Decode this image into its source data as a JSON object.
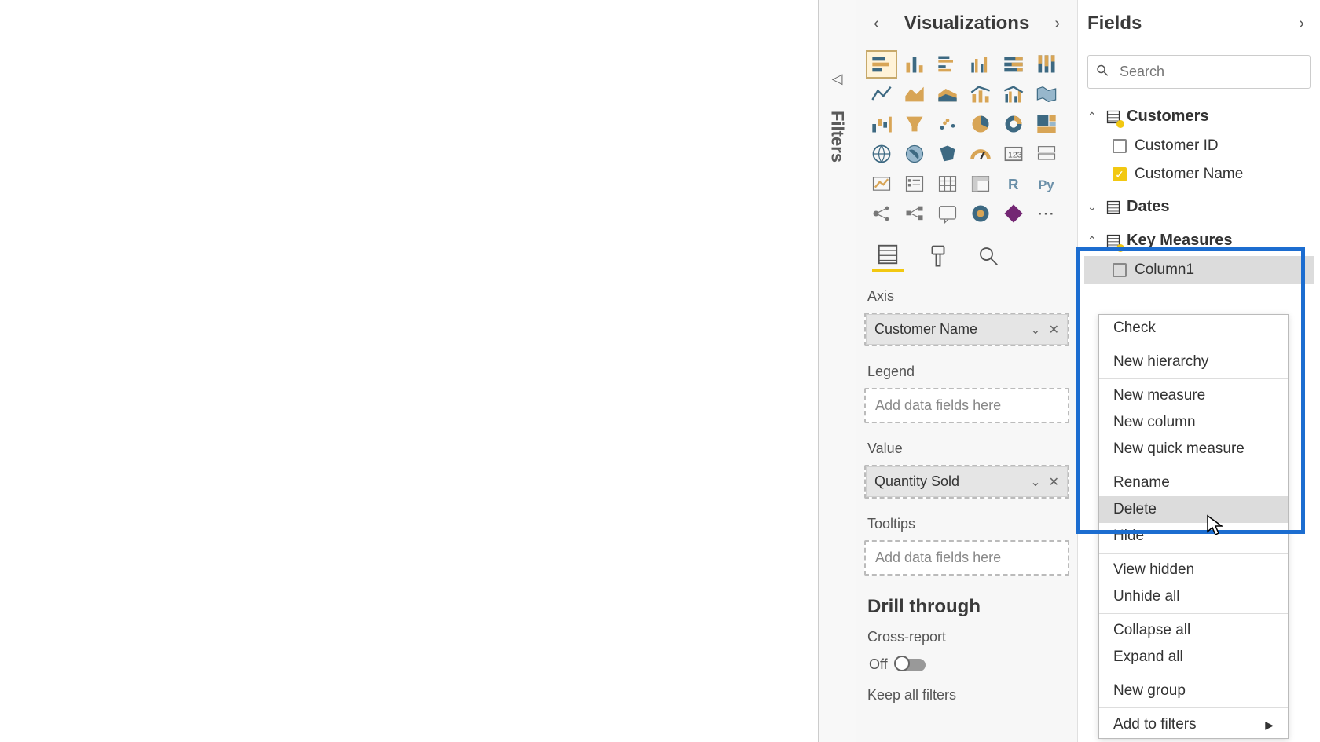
{
  "filters_label": "Filters",
  "visualizations": {
    "title": "Visualizations",
    "wells": {
      "axis_label": "Axis",
      "axis_field": "Customer Name",
      "legend_label": "Legend",
      "legend_placeholder": "Add data fields here",
      "value_label": "Value",
      "value_field": "Quantity Sold",
      "tooltips_label": "Tooltips",
      "tooltips_placeholder": "Add data fields here"
    },
    "drill": {
      "heading": "Drill through",
      "cross_report_label": "Cross-report",
      "cross_report_state": "Off",
      "keep_all_filters_label": "Keep all filters"
    }
  },
  "fields": {
    "title": "Fields",
    "search_placeholder": "Search",
    "tables": {
      "customers": {
        "name": "Customers",
        "items": [
          {
            "label": "Customer ID",
            "checked": false
          },
          {
            "label": "Customer Name",
            "checked": true
          }
        ]
      },
      "dates": {
        "name": "Dates"
      },
      "key_measures": {
        "name": "Key Measures",
        "items": [
          {
            "label": "Column1",
            "checked": false
          }
        ]
      }
    }
  },
  "context_menu": {
    "check": "Check",
    "new_hierarchy": "New hierarchy",
    "new_measure": "New measure",
    "new_column": "New column",
    "new_quick_measure": "New quick measure",
    "rename": "Rename",
    "delete": "Delete",
    "hide": "Hide",
    "view_hidden": "View hidden",
    "unhide_all": "Unhide all",
    "collapse_all": "Collapse all",
    "expand_all": "Expand all",
    "new_group": "New group",
    "add_to_filters": "Add to filters"
  }
}
